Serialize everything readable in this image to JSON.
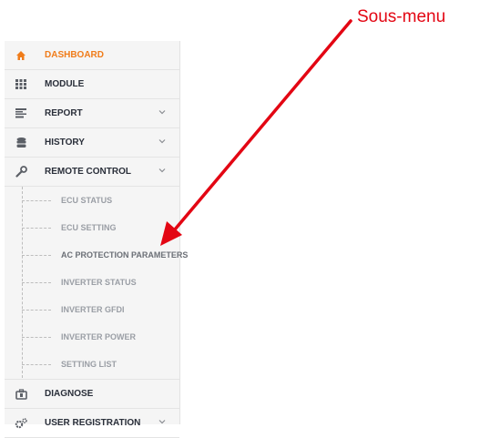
{
  "annotation": {
    "label": "Sous-menu",
    "color": "#e30613"
  },
  "sidebar": {
    "accent_color": "#f07c1a",
    "items": [
      {
        "label": "DASHBOARD",
        "icon": "home-icon",
        "active": true
      },
      {
        "label": "MODULE",
        "icon": "grid-icon"
      },
      {
        "label": "REPORT",
        "icon": "report-icon",
        "has_chevron": true
      },
      {
        "label": "HISTORY",
        "icon": "database-icon",
        "has_chevron": true
      },
      {
        "label": "REMOTE CONTROL",
        "icon": "wrench-icon",
        "has_chevron": true,
        "expanded": true
      },
      {
        "label": "DIAGNOSE",
        "icon": "toolbox-icon"
      },
      {
        "label": "USER REGISTRATION",
        "icon": "gears-icon",
        "has_chevron": true
      }
    ],
    "remote_control_submenu": [
      "ECU STATUS",
      "ECU SETTING",
      "AC PROTECTION PARAMETERS",
      "INVERTER STATUS",
      "INVERTER GFDI",
      "INVERTER POWER",
      "SETTING LIST"
    ]
  }
}
